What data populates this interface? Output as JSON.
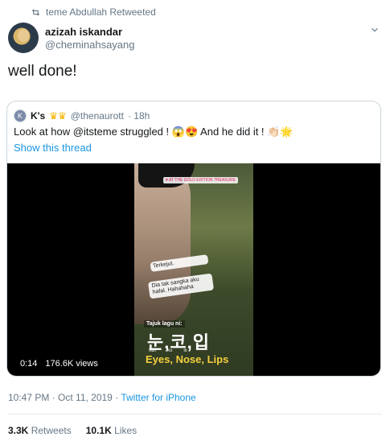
{
  "retweet": {
    "text": "teme Abdullah Retweeted",
    "icon": "retweet-icon"
  },
  "author": {
    "name": "azizah iskandar",
    "handle": "@cheminahsayang"
  },
  "tweet": {
    "text": "well done!"
  },
  "quoted": {
    "name": "K's",
    "crown_icon": "crown-icon",
    "handle": "@thenaurott",
    "time": "· 18h",
    "text_part1": "Look at how @itsteme struggled !",
    "emoji1": "😱😍",
    "text_part2": "And he did it !",
    "emoji2": "👏🏻🌟",
    "show_thread": "Show this thread",
    "video": {
      "tag": "♥ AT THE GOLD EDITION TREASURE",
      "sticker1": "Terkejut.",
      "sticker2": "Dia tak sangka aku hafal. Hahahaha",
      "lesson_label": "Tajuk lagu ni:",
      "korean": "눈,코,입",
      "romaji": [
        "Nun",
        "Ko",
        "Ib"
      ],
      "english": "Eyes, Nose, Lips",
      "duration": "0:14",
      "views": "176.6K views"
    }
  },
  "meta": {
    "datetime": "10:47 PM · Oct 11, 2019",
    "separator": "·",
    "source": "Twitter for iPhone"
  },
  "stats": {
    "retweets_count": "3.3K",
    "retweets_label": "Retweets",
    "likes_count": "10.1K",
    "likes_label": "Likes"
  },
  "colors": {
    "link": "#1b95e0",
    "muted": "#657786",
    "text": "#14171a",
    "border": "#ccd6dd"
  }
}
